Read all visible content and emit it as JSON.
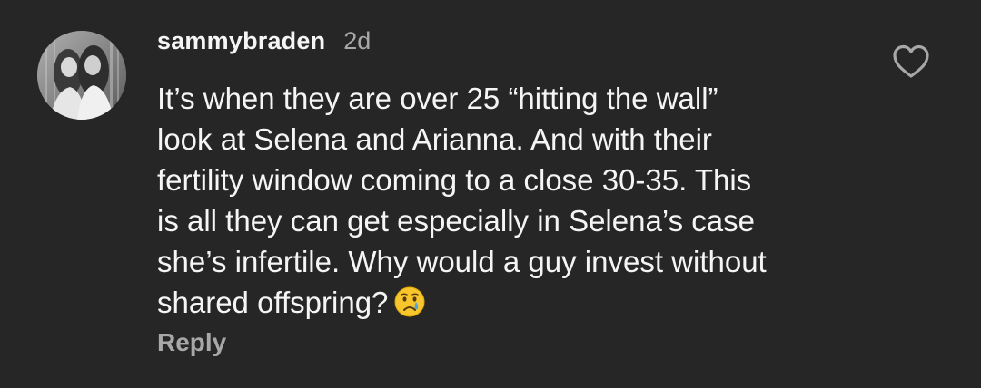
{
  "comment": {
    "username": "sammybraden",
    "timestamp": "2d",
    "lines": [
      "It’s when they are over 25 “hitting the wall”",
      "look at Selena and Arianna. And with their",
      "fertility window coming to a close 30-35. This",
      "is all they can get especially in Selena’s case",
      "she’s infertile. Why would a guy invest without",
      "shared offspring?"
    ],
    "emoji": "crying-face-emoji",
    "reply_label": "Reply",
    "like_icon": "heart-outline-icon",
    "avatar_icon": "profile-photo-two-women"
  },
  "colors": {
    "background": "#262626",
    "primary_text": "#f5f5f5",
    "secondary_text": "#a8a8a8"
  }
}
